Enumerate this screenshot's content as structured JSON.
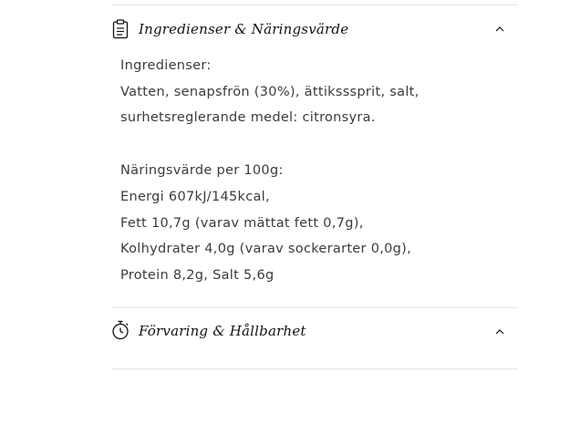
{
  "accordions": [
    {
      "title": "Ingredienser & Näringsvärde",
      "icon": "clipboard-icon",
      "expanded": true,
      "content": {
        "ingredients_heading": "Ingredienser:",
        "ingredients_line1": "Vatten, senapsfrön (30%), ättiksssprit, salt,",
        "ingredients_line2": "surhetsreglerande medel: citronsyra.",
        "nutrition_heading": "Näringsvärde per 100g:",
        "nutrition_energy": "Energi 607kJ/145kcal,",
        "nutrition_fat": "Fett 10,7g (varav mättat fett 0,7g),",
        "nutrition_carbs": "Kolhydrater 4,0g (varav sockerarter 0,0g),",
        "nutrition_protein": "Protein 8,2g, Salt 5,6g"
      }
    },
    {
      "title": "Förvaring & Hållbarhet",
      "icon": "stopwatch-icon",
      "expanded": false
    }
  ],
  "colors": {
    "text": "#121212",
    "body_text": "#3b3b3b",
    "divider": "#e6e6e6"
  }
}
